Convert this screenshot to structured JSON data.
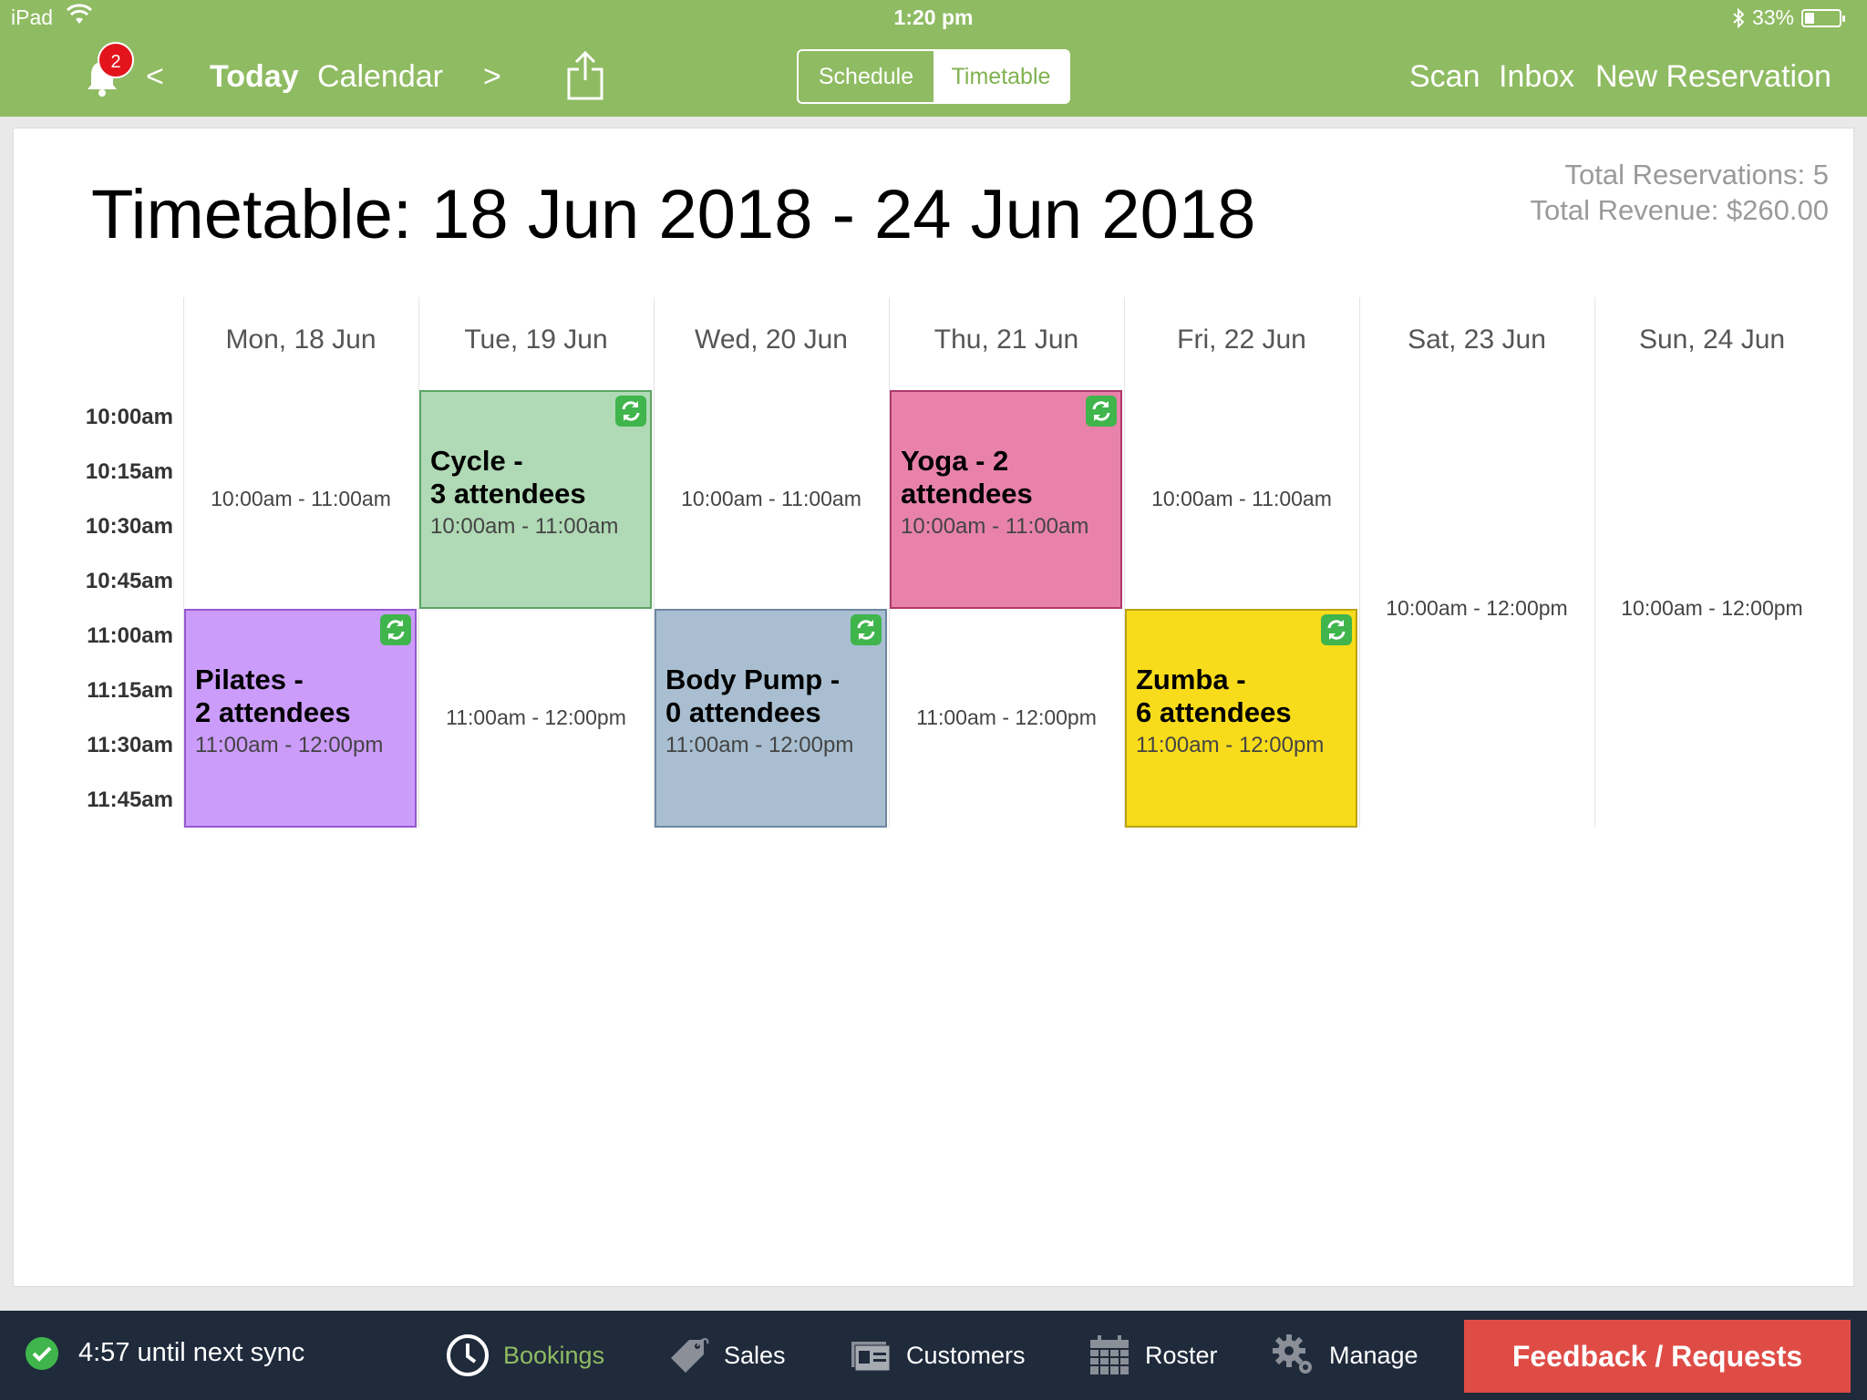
{
  "status_bar": {
    "device": "iPad",
    "time": "1:20 pm",
    "battery": "33%"
  },
  "nav": {
    "notification_count": "2",
    "prev": "<",
    "today": "Today",
    "calendar": "Calendar",
    "next": ">",
    "segments": {
      "schedule": "Schedule",
      "timetable": "Timetable"
    },
    "scan": "Scan",
    "inbox": "Inbox",
    "new_reservation": "New Reservation"
  },
  "colors": {
    "topbar": "#8fbb62",
    "bottombar": "#1f2a3b",
    "feedback": "#df4c46",
    "sync_icon": "#3fb54c"
  },
  "timetable": {
    "title": "Timetable: 18 Jun 2018 - 24 Jun 2018",
    "total_reservations": "Total Reservations: 5",
    "total_revenue": "Total Revenue: $260.00",
    "days": [
      "Mon, 18 Jun",
      "Tue, 19 Jun",
      "Wed, 20 Jun",
      "Thu, 21 Jun",
      "Fri, 22 Jun",
      "Sat, 23 Jun",
      "Sun, 24 Jun"
    ],
    "times": [
      "10:00am",
      "10:15am",
      "10:30am",
      "10:45am",
      "11:00am",
      "11:15am",
      "11:30am",
      "11:45am"
    ],
    "empty_slots": [
      "10:00am - 11:00am",
      "11:00am - 12:00pm",
      "10:00am - 11:00am",
      "11:00am - 12:00pm",
      "10:00am - 11:00am",
      "10:00am - 12:00pm",
      "10:00am - 12:00pm"
    ],
    "events": [
      {
        "title_line1": "Cycle -",
        "title_line2": "3 attendees",
        "time": "10:00am - 11:00am",
        "color": "#b0d9b5",
        "border": "#5aa563"
      },
      {
        "title_line1": "Yoga - 2",
        "title_line2": "attendees",
        "time": "10:00am - 11:00am",
        "color": "#e882ab",
        "border": "#b0396b"
      },
      {
        "title_line1": "Pilates -",
        "title_line2": "2 attendees",
        "time": "11:00am - 12:00pm",
        "color": "#cc9cfa",
        "border": "#9558cf"
      },
      {
        "title_line1": "Body Pump -",
        "title_line2": "0 attendees",
        "time": "11:00am - 12:00pm",
        "color": "#a9bfd1",
        "border": "#6d87a0"
      },
      {
        "title_line1": "Zumba -",
        "title_line2": "6 attendees",
        "time": "11:00am - 12:00pm",
        "color": "#f8dc1b",
        "border": "#b9a313"
      }
    ]
  },
  "bottom": {
    "sync_text": "4:57 until next sync",
    "tabs": {
      "bookings": "Bookings",
      "sales": "Sales",
      "customers": "Customers",
      "roster": "Roster",
      "manage": "Manage"
    },
    "feedback": "Feedback / Requests"
  }
}
